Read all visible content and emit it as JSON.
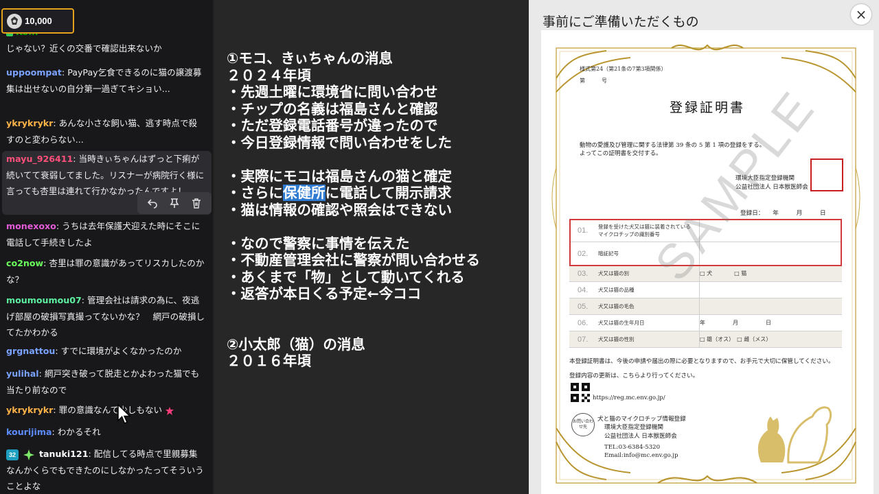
{
  "points": {
    "value": "10,000"
  },
  "chat": {
    "messages": [
      {
        "user": "",
        "text": "じゃない？近くの交番で確認出来ないか",
        "color": "#00ad03"
      },
      {
        "user": "uppoompat",
        "text": "PayPay乞食できるのに猫の譲渡募集は出せないの自分第一過ぎてキショい...",
        "color": "#7aa2ff"
      },
      {
        "user": "ykrykrykr",
        "text": "あんな小さな飼い猫、逃す時点で殺すのと変わらない...",
        "color": "#ffb347"
      },
      {
        "user": "mayu_926411",
        "text": "当時きぃちゃんはずっと下痢が続いてて衰弱してました。リスナーが病院行く様に言っても杏里は連れて行かなかったんですよ！",
        "color": "#ff4f7b"
      },
      {
        "user": "monexoxo",
        "text": "うちは去年保護犬迎えた時にそこに電話して手続きしたよ",
        "color": "#e35bd8"
      },
      {
        "user": "co2now",
        "text": "杏里は罪の意識があってリスカしたのかな？",
        "color": "#6bff5c"
      },
      {
        "user": "moumoumou07",
        "text": "管理会社は請求の為に、夜逃げ部屋の破損写真撮ってないかな？　網戸の破損してたかわかる",
        "color": "#5cf0a0"
      },
      {
        "user": "grgnattou",
        "text": "すでに環境がよくなかったのか",
        "color": "#7aa2ff"
      },
      {
        "user": "yulihal",
        "text": "網戸突き破って脱走とかよわった猫でも当たり前なので",
        "color": "#7aa2ff"
      },
      {
        "user": "ykrykrykr",
        "text": "罪の意識なんて少しもない",
        "color": "#ffb347"
      },
      {
        "user": "kourijima",
        "text": "わかるそれ",
        "color": "#5c8cff"
      },
      {
        "user": "tanuki121",
        "text": "配信してる時点で里親募集なんかくらでもできたのにしなかったってそういうことよな",
        "color": "#ffffff",
        "badge": "32"
      }
    ],
    "actions": [
      "reply-icon",
      "pin-icon",
      "delete-icon"
    ]
  },
  "notes": [
    "①モコ、きぃちゃんの消息",
    "２０２４年頃",
    "・先週土曜に環境省に問い合わせ",
    "・チップの名義は福島さんと確認",
    "・ただ登録電話番号が違ったので",
    "・今日登録情報で問い合わせをした",
    "",
    "・実際にモコは福島さんの猫と確定",
    "・さらに保健所に電話して開示請求",
    "・猫は情報の確認や照会はできない",
    "",
    "・なので警察に事情を伝えた",
    "・不動産管理会社に警察が問い合わせる",
    "・あくまで「物」として動いてくれる",
    "・返答が本日くる予定←今ココ",
    "",
    "",
    "②小太郎（猫）の消息",
    "２０１６年頃"
  ],
  "notes_selected_word": "保健所",
  "panel": {
    "title": "事前にご準備いただくもの",
    "close_label": "×"
  },
  "certificate": {
    "form_no": "様式第24（第21条の7第3項関係）",
    "number_label": "第　　　号",
    "heading": "登録証明書",
    "body1": "動物の愛護及び管理に関する法律第 39 条の 5 第 1 項の登録をする。",
    "body2": "よってこの証明書を交付する。",
    "org1": "環境大臣指定登録機関",
    "org2": "公益社団法人 日本獣医師会",
    "date_label": "登録日：　　年　　　月　　　日",
    "rows": [
      {
        "num": "01.",
        "label": "登録を受けた犬又は猫に装着されている\nマイクロチップの識別番号",
        "value": ""
      },
      {
        "num": "02.",
        "label": "暗証記号",
        "value": ""
      },
      {
        "num": "03.",
        "label": "犬又は猫の別",
        "value": "□ 犬　　　　□ 猫"
      },
      {
        "num": "04.",
        "label": "犬又は猫の品種",
        "value": ""
      },
      {
        "num": "05.",
        "label": "犬又は猫の毛色",
        "value": ""
      },
      {
        "num": "06.",
        "label": "犬又は猫の生年月日",
        "value": "年　　　　　月　　　　　日"
      },
      {
        "num": "07.",
        "label": "犬又は猫の性別",
        "value": "□ 雄（オス）　□ 雌（メス）"
      }
    ],
    "note1": "本登録証明書は、今後の申請や届出の際に必要となりますので、お手元で大切に保管してください。",
    "note2": "登録内容の更新は、こちらより行ってください。",
    "url": "https://reg.mc.env.go.jp/",
    "contact_circle": "お問い合わせ先",
    "contact1": "犬と猫のマイクロチップ情報登録",
    "contact2": "環境大臣指定登録機関",
    "contact3": "公益社団法人 日本獣医師会",
    "tel": "TEL:03-6384-5320",
    "email": "Email:info@mc.env.go.jp",
    "watermark": "SAMPLE"
  }
}
